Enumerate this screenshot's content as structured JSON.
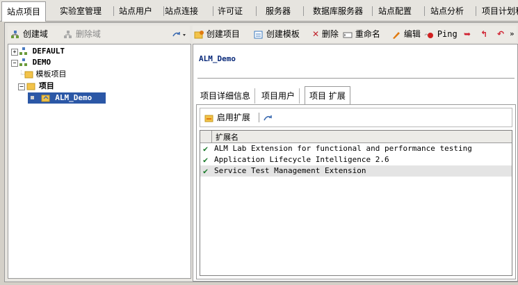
{
  "top_tabs": [
    {
      "label": "站点项目",
      "active": true
    },
    {
      "label": "实验室管理"
    },
    {
      "label": "站点用户"
    },
    {
      "label": "站点连接"
    },
    {
      "label": "许可证"
    },
    {
      "label": "服务器"
    },
    {
      "label": "数据库服务器"
    },
    {
      "label": "站点配置"
    },
    {
      "label": "站点分析"
    },
    {
      "label": "项目计划和跟踪"
    }
  ],
  "left_toolbar": {
    "create_domain": "创建域",
    "delete_domain": "删除域"
  },
  "tree": {
    "default_domain": "DEFAULT",
    "demo_domain": "DEMO",
    "template_projects": "模板项目",
    "projects": "项目",
    "selected_project": "ALM_Demo"
  },
  "right_toolbar": {
    "create_project": "创建项目",
    "create_template": "创建模板",
    "delete": "删除",
    "rename": "重命名",
    "edit": "编辑",
    "ping": "Ping",
    "more": "»"
  },
  "project": {
    "title": "ALM_Demo",
    "tabs": [
      {
        "label": "项目详细信息"
      },
      {
        "label": "项目用户"
      },
      {
        "label": "项目 扩展",
        "active": true
      }
    ],
    "enable_extension": "启用扩展",
    "table_header": "扩展名",
    "extensions": [
      "ALM Lab Extension for functional and performance testing",
      "Application Lifecycle Intelligence 2.6",
      "Service Test Management Extension"
    ]
  },
  "colors": {
    "check": "#1a7a2a",
    "selection": "#2b57a6",
    "title": "#0a2a7a"
  }
}
